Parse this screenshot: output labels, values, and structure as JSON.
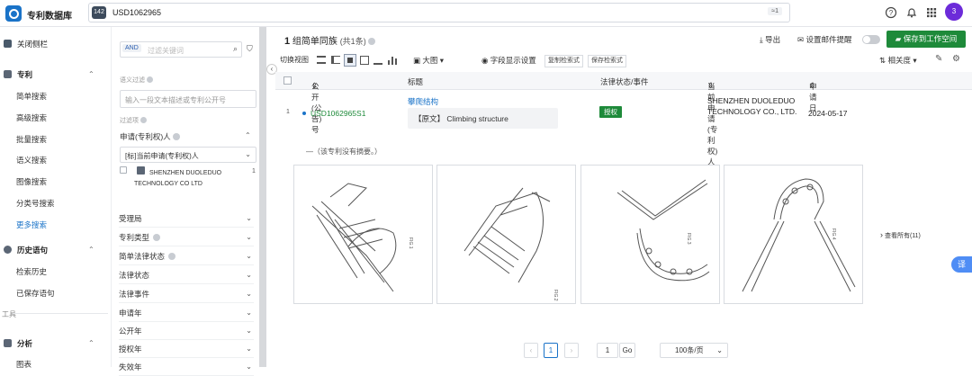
{
  "app": {
    "title": "专利数据库"
  },
  "search": {
    "badge": "142",
    "query": "USD1062965",
    "count_badge": "≈1"
  },
  "avatar": {
    "initial": "3"
  },
  "colors": {
    "accent": "#1e8a3a",
    "brand": "#1a73c8",
    "avatar": "#6c2bd9"
  },
  "leftnav": {
    "collapse": "关闭侧栏",
    "patent": "专利",
    "items": [
      "简单搜索",
      "高级搜索",
      "批量搜索",
      "语义搜索",
      "图像搜索",
      "分类号搜索",
      "更多搜索"
    ],
    "history": "历史语句",
    "history_items": [
      "检索历史",
      "已保存语句"
    ],
    "tools": "工具",
    "analysis": "分析",
    "analysis_items": [
      "图表"
    ]
  },
  "filter": {
    "and": "AND",
    "placeholder": "过滤关键词",
    "semantic_label": "语义过滤",
    "semantic_placeholder": "输入一段文本描述或专利公开号",
    "filter_items_label": "过滤项",
    "applicant_head": "申请(专利权)人",
    "applicant_select": "[标]当前申请(专利权)人",
    "applicant_option": "SHENZHEN DUOLEDUO TECHNOLOGY CO LTD",
    "applicant_count": "1",
    "facets": [
      "受理局",
      "专利类型",
      "简单法律状态",
      "法律状态",
      "法律事件",
      "申请年",
      "公开年",
      "授权年",
      "失效年"
    ]
  },
  "main": {
    "result_bold": "1",
    "result_text": "组简单同族",
    "result_sub": "(共1条)",
    "export": "导出",
    "email_alert": "设置邮件提醒",
    "save_workspace": "保存到工作空间",
    "switch_view": "切换视图",
    "big_image": "大图",
    "field_display": "字段显示设置",
    "copy_query": "复制检索式",
    "save_query": "保存检索式",
    "relevance": "相关度"
  },
  "table": {
    "headers": [
      "公开(公告)号",
      "标题",
      "法律状态/事件",
      "当前申请(专利权)人",
      "申请日"
    ],
    "row": {
      "index": "1",
      "pub_no": "USD1062965S1",
      "title_cn": "攀爬结构",
      "title_orig": "【原文】 Climbing structure",
      "status": "授权",
      "applicant": "SHENZHEN DUOLEDUO TECHNOLOGY CO., LTD.",
      "date": "2024-05-17"
    },
    "no_abstract": "—（该专利没有摘要。）",
    "figs": [
      "FIG.1",
      "FIG.2",
      "FIG.3",
      "FIG.4"
    ],
    "view_all": "查看所有(11)"
  },
  "pagination": {
    "page": "1",
    "goto": "1",
    "go": "Go",
    "per_page": "100条/页"
  },
  "float_btn": "译"
}
